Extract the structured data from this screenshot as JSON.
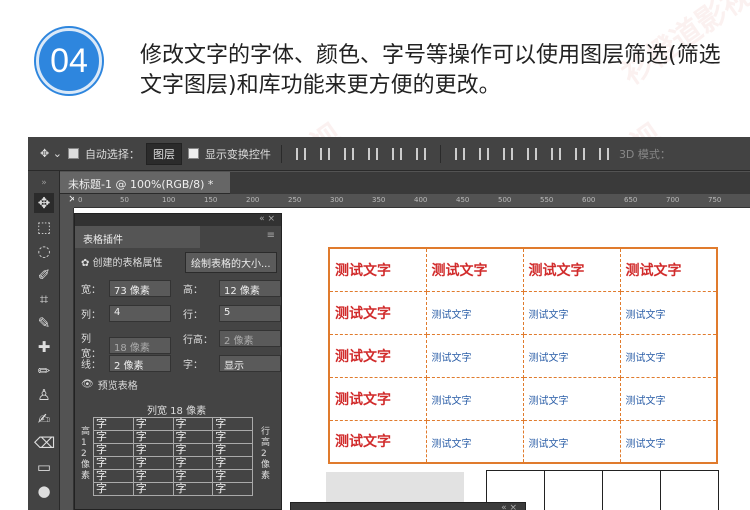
{
  "step": {
    "number": "04",
    "text": "修改文字的字体、颜色、字号等操作可以使用图层筛选(筛选文字图层)和库功能来更方便的更改。"
  },
  "optbar": {
    "auto_select_label": "自动选择：",
    "auto_select_value": "图层",
    "show_transform_label": "显示变换控件",
    "mode_3d_label": "3D 模式："
  },
  "doc_tab": {
    "title": "未标题-1 @ 100%(RGB/8) *",
    "close": "×"
  },
  "ruler_h": [
    "0",
    "50",
    "100",
    "150",
    "200",
    "250",
    "300",
    "350",
    "400",
    "450",
    "500",
    "550",
    "600",
    "650",
    "700",
    "750"
  ],
  "panel": {
    "collapse": "«  ×",
    "tab_label": "表格插件",
    "menu_icon": "≡",
    "section_label": "✿ 创建的表格属性",
    "draw_button": "绘制表格的大小...",
    "width_label": "宽：",
    "width_value": "73 像素",
    "height_label": "高：",
    "height_value": "12 像素",
    "cols_label": "列：",
    "cols_value": "4",
    "rows_label": "行：",
    "rows_value": "5",
    "col_width_label": "列宽：",
    "col_width_value": "18 像素",
    "row_height_label": "行高：",
    "row_height_value": "2 像素",
    "line_label": "线：",
    "line_value": "2 像素",
    "char_label": "字：",
    "char_value": "显示",
    "preview_label": "预览表格",
    "preview_col_width": "列宽 18 像素",
    "preview_left_label": "高 1 2 像素",
    "preview_right_label": "行高 2 像素",
    "preview_cell_char": "字"
  },
  "table": {
    "header_row": [
      "测试文字",
      "测试文字",
      "测试文字",
      "测试文字"
    ],
    "body_first_col": "测试文字",
    "body_other": "测试文字",
    "rows": 5,
    "cols": 4
  },
  "colors": {
    "accent": "#2e86de",
    "table_border": "#e07b2d",
    "big_text": "#d12b2b",
    "small_text": "#2c5fa8"
  },
  "panel2": {
    "controls": "«  ×"
  },
  "watermark": "衫橙道影视"
}
